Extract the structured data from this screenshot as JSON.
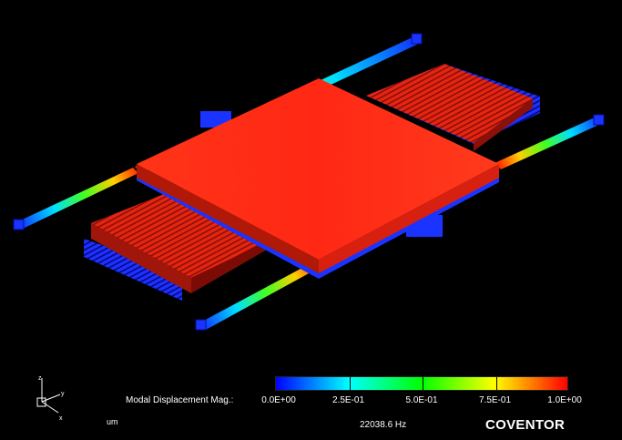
{
  "legend": {
    "title": "Modal Displacement Mag.:",
    "ticks": [
      "0.0E+00",
      "2.5E-01",
      "5.0E-01",
      "7.5E-01",
      "1.0E+00"
    ],
    "colors": [
      "#0000ff",
      "#00ffff",
      "#00ff00",
      "#ffff00",
      "#ff0000"
    ]
  },
  "frequency": "22038.6 Hz",
  "units": "um",
  "brand": "COVENTOR",
  "axes": {
    "x": "x",
    "y": "y",
    "z": "z"
  },
  "palette": {
    "background": "#000000",
    "plate": "#ff2a1a",
    "anchor": "#1a33ff"
  }
}
